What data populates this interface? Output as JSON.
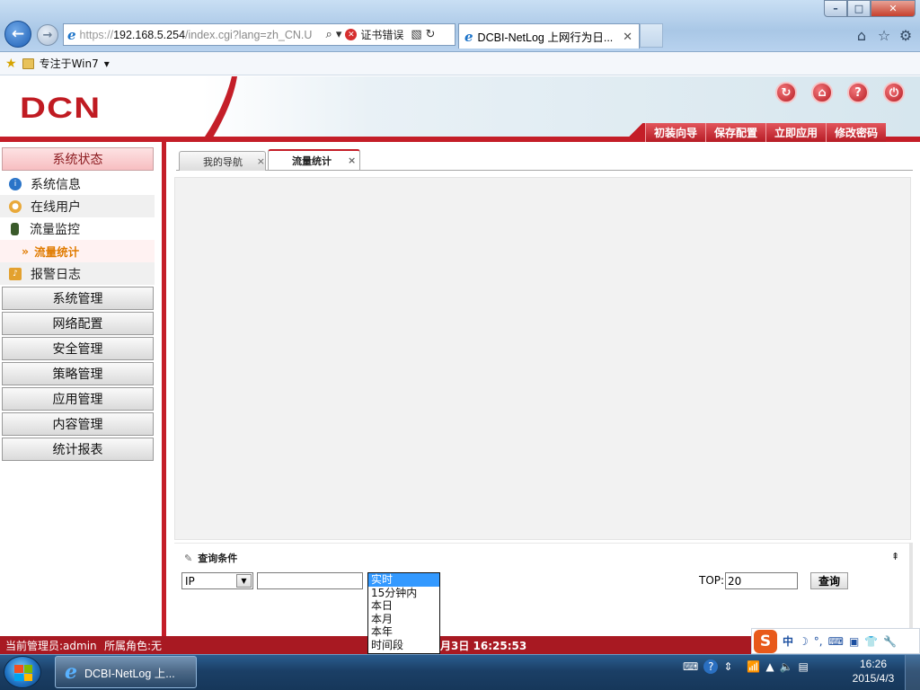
{
  "browser": {
    "url_scheme": "https://",
    "url_host": "192.168.5.254",
    "url_rest": "/index.cgi?lang=zh_CN.U",
    "cert_error": "证书错误",
    "active_tab_title": "DCBI-NetLog 上网行为日...",
    "favorites_item": "专注于Win7"
  },
  "header": {
    "logo": "DCN",
    "buttons": [
      "初装向导",
      "保存配置",
      "立即应用",
      "修改密码"
    ],
    "icons": [
      "refresh-icon",
      "home-icon",
      "help-icon",
      "logout-icon"
    ]
  },
  "sidebar": {
    "status_header": "系统状态",
    "status_items": [
      {
        "label": "系统信息",
        "icon": "info-icon"
      },
      {
        "label": "在线用户",
        "icon": "user-icon"
      },
      {
        "label": "流量监控",
        "icon": "traffic-light-icon"
      }
    ],
    "active_sub": "流量统计",
    "alarm_item": "报警日志",
    "sections": [
      "系统管理",
      "网络配置",
      "安全管理",
      "策略管理",
      "应用管理",
      "内容管理",
      "统计报表"
    ]
  },
  "page_tabs": [
    {
      "label": "我的导航",
      "close": "×"
    },
    {
      "label": "流量统计",
      "close": "×"
    }
  ],
  "query": {
    "title": "查询条件",
    "pin": "⇞",
    "type_select": "IP",
    "ip_value": "",
    "time_options": [
      "实时",
      "15分钟内",
      "本日",
      "本月",
      "本年",
      "时间段"
    ],
    "time_selected": "实时",
    "top_label": "TOP:",
    "top_value": "20",
    "submit": "查询"
  },
  "statusbar": {
    "admin": "当前管理员:admin",
    "role": "所属角色:无",
    "datetime": "月3日  16:25:53"
  },
  "ime": {
    "logo": "S",
    "mode": "中"
  },
  "taskbar": {
    "ie_title": "DCBI-NetLog 上...",
    "time": "16:26",
    "date": "2015/4/3"
  },
  "colors": {
    "brand_red": "#c41e28",
    "selection_blue": "#3399ff"
  }
}
